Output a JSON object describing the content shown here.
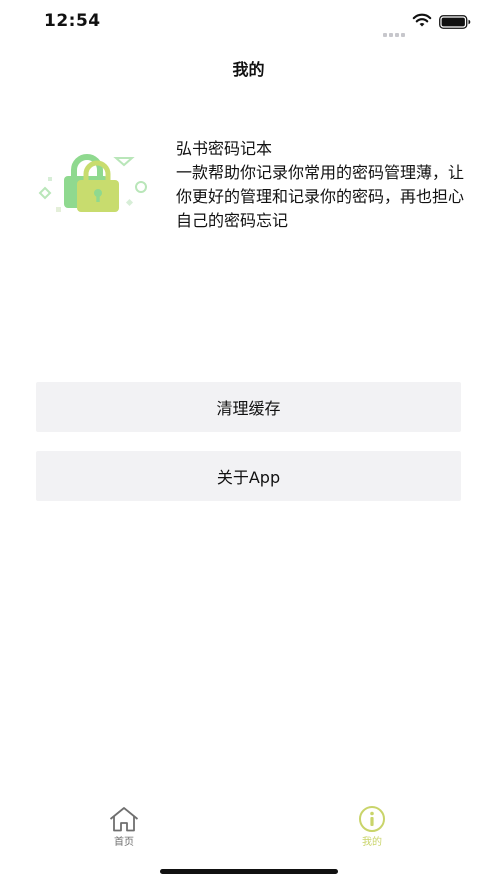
{
  "status_bar": {
    "time": "12:54"
  },
  "nav": {
    "title": "我的"
  },
  "about": {
    "app_name": "弘书密码记本",
    "description": "一款帮助你记录你常用的密码管理薄，让你更好的管理和记录你的密码，再也担心自己的密码忘记"
  },
  "menu": {
    "clear_cache": "清理缓存",
    "about_app": "关于App"
  },
  "tab_bar": {
    "items": [
      {
        "label": "首页",
        "icon": "home-icon",
        "active": false
      },
      {
        "label": "我的",
        "icon": "info-icon",
        "active": true
      }
    ]
  },
  "colors": {
    "active_tab": "#c9d46a",
    "inactive_tab": "#6f6f6f",
    "button_bg": "#f2f2f4",
    "lock_green": "#8fd98f",
    "lock_lime": "#c8dc6e"
  }
}
